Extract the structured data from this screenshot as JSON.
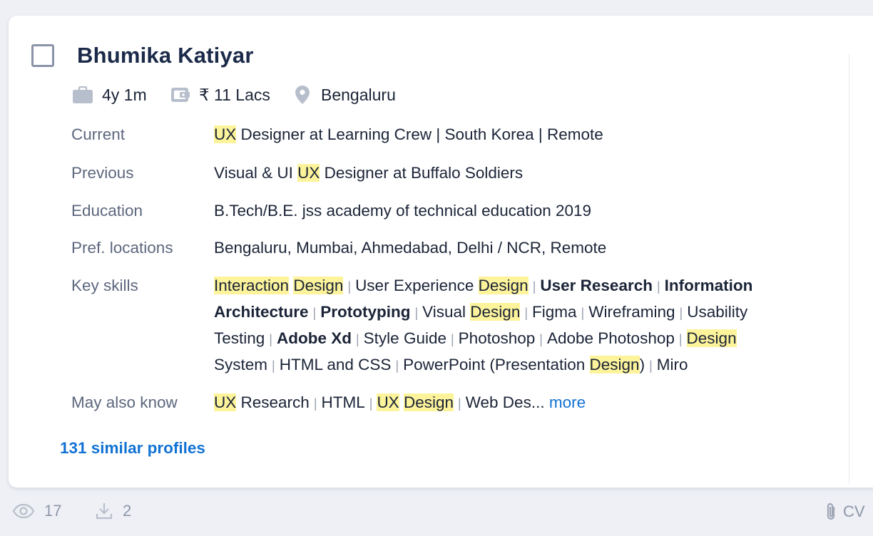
{
  "candidate": {
    "name": "Bhumika Katiyar",
    "experience": "4y 1m",
    "salary": "₹ 11 Lacs",
    "location": "Bengaluru"
  },
  "details": {
    "current_label": "Current",
    "current": [
      {
        "t": "UX",
        "hl": true
      },
      {
        "t": " Designer at Learning Crew | South Korea | Remote"
      }
    ],
    "previous_label": "Previous",
    "previous": [
      {
        "t": "Visual & UI "
      },
      {
        "t": "UX",
        "hl": true
      },
      {
        "t": " Designer at Buffalo Soldiers"
      }
    ],
    "education_label": "Education",
    "education": "B.Tech/B.E. jss academy of technical education 2019",
    "pref_label": "Pref. locations",
    "pref_locations": "Bengaluru, Mumbai, Ahmedabad, Delhi / NCR, Remote",
    "skills_label": "Key skills",
    "key_skills": [
      [
        {
          "t": "Interaction",
          "hl": true
        },
        {
          "t": " "
        },
        {
          "t": "Design",
          "hl": true
        }
      ],
      [
        {
          "t": "User Experience "
        },
        {
          "t": "Design",
          "hl": true
        }
      ],
      [
        {
          "t": "User Research",
          "b": true
        }
      ],
      [
        {
          "t": "Information Architecture",
          "b": true
        }
      ],
      [
        {
          "t": "Prototyping",
          "b": true
        }
      ],
      [
        {
          "t": "Visual "
        },
        {
          "t": "Design",
          "hl": true
        }
      ],
      [
        {
          "t": "Figma"
        }
      ],
      [
        {
          "t": "Wireframing"
        }
      ],
      [
        {
          "t": "Usability Testing"
        }
      ],
      [
        {
          "t": "Adobe Xd",
          "b": true
        }
      ],
      [
        {
          "t": "Style Guide"
        }
      ],
      [
        {
          "t": "Photoshop"
        }
      ],
      [
        {
          "t": "Adobe Photoshop"
        }
      ],
      [
        {
          "t": "Design",
          "hl": true
        },
        {
          "t": " System"
        }
      ],
      [
        {
          "t": "HTML and CSS"
        }
      ],
      [
        {
          "t": "PowerPoint (Presentation "
        },
        {
          "t": "Design",
          "hl": true
        },
        {
          "t": ")"
        }
      ],
      [
        {
          "t": "Miro"
        }
      ]
    ],
    "also_know_label": "May also know",
    "also_know": [
      [
        {
          "t": "UX",
          "hl": true
        },
        {
          "t": " Research"
        }
      ],
      [
        {
          "t": "HTML"
        }
      ],
      [
        {
          "t": "UX",
          "hl": true
        },
        {
          "t": " "
        },
        {
          "t": "Design",
          "hl": true
        }
      ],
      [
        {
          "t": "Web Des..."
        }
      ]
    ],
    "more_label": "more"
  },
  "similar_profiles": "131 similar profiles",
  "footer": {
    "views": "17",
    "downloads": "2",
    "cv_label": "CV"
  },
  "colors": {
    "highlight": "#fdf39b",
    "link": "#1272d3",
    "label": "#5c677d",
    "icon": "#b8bfcc"
  },
  "icons": [
    "briefcase-icon",
    "wallet-icon",
    "location-pin-icon",
    "eye-icon",
    "download-icon",
    "paperclip-icon"
  ]
}
